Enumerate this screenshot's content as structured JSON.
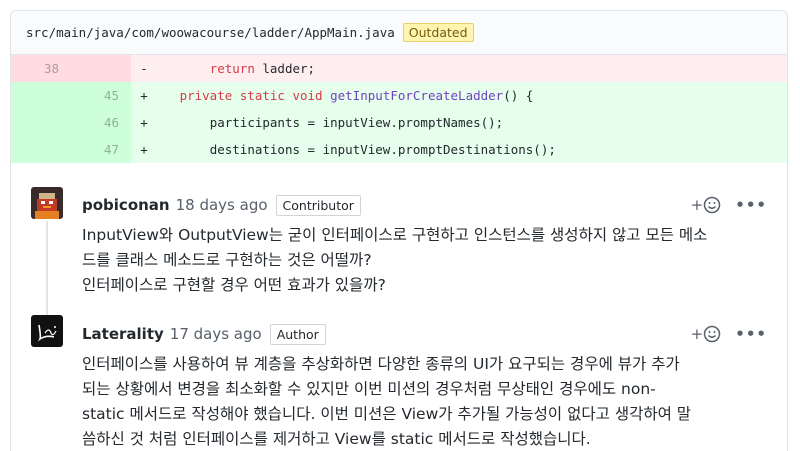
{
  "file": {
    "path": "src/main/java/com/woowacourse/ladder/AppMain.java",
    "badge": "Outdated"
  },
  "diff": [
    {
      "type": "del",
      "old_ln": "38",
      "new_ln": "",
      "sign": "-",
      "indent": "       ",
      "tokens": [
        {
          "t": "return",
          "c": "kw"
        },
        {
          "t": " ladder;",
          "c": ""
        }
      ]
    },
    {
      "type": "add",
      "old_ln": "",
      "new_ln": "45",
      "sign": "+",
      "indent": "   ",
      "tokens": [
        {
          "t": "private static void",
          "c": "kw"
        },
        {
          "t": " ",
          "c": ""
        },
        {
          "t": "getInputForCreateLadder",
          "c": "fn"
        },
        {
          "t": "() {",
          "c": ""
        }
      ]
    },
    {
      "type": "add",
      "old_ln": "",
      "new_ln": "46",
      "sign": "+",
      "indent": "       ",
      "tokens": [
        {
          "t": "participants",
          "c": ""
        },
        {
          "t": " = ",
          "c": ""
        },
        {
          "t": "inputView",
          "c": ""
        },
        {
          "t": ".promptNames();",
          "c": ""
        }
      ]
    },
    {
      "type": "add",
      "old_ln": "",
      "new_ln": "47",
      "sign": "+",
      "indent": "       ",
      "tokens": [
        {
          "t": "destinations",
          "c": ""
        },
        {
          "t": " = ",
          "c": ""
        },
        {
          "t": "inputView",
          "c": ""
        },
        {
          "t": ".promptDestinations();",
          "c": ""
        }
      ]
    }
  ],
  "comments": [
    {
      "author": "pobiconan",
      "time": "18 days ago",
      "role": "Contributor",
      "body": [
        "InputView와 OutputView는 굳이 인터페이스로 구현하고 인스턴스를 생성하지 않고 모든 메소",
        "드를 클래스 메소드로 구현하는 것은 어떨까?",
        "인터페이스로 구현할 경우 어떤 효과가 있을까?"
      ],
      "react_label": "+",
      "more_label": "•••"
    },
    {
      "author": "Laterality",
      "time": "17 days ago",
      "role": "Author",
      "body": [
        "인터페이스를 사용하여 뷰 계층을 추상화하면 다양한 종류의 UI가 요구되는 경우에 뷰가 추가",
        "되는 상황에서 변경을 최소화할 수 있지만 이번 미션의 경우처럼 무상태인 경우에도 non-",
        "static 메서드로 작성해야 했습니다. 이번 미션은 View가 추가될 가능성이 없다고 생각하여 말",
        "씀하신 것 처럼 인터페이스를 제거하고 View를 static 메서드로 작성했습니다."
      ],
      "react_label": "+",
      "more_label": "•••"
    }
  ],
  "icons": {
    "avatar1": "pixel-art-avatar-icon",
    "avatar2": "signature-logo-avatar-icon",
    "reaction": "smiley-icon"
  }
}
